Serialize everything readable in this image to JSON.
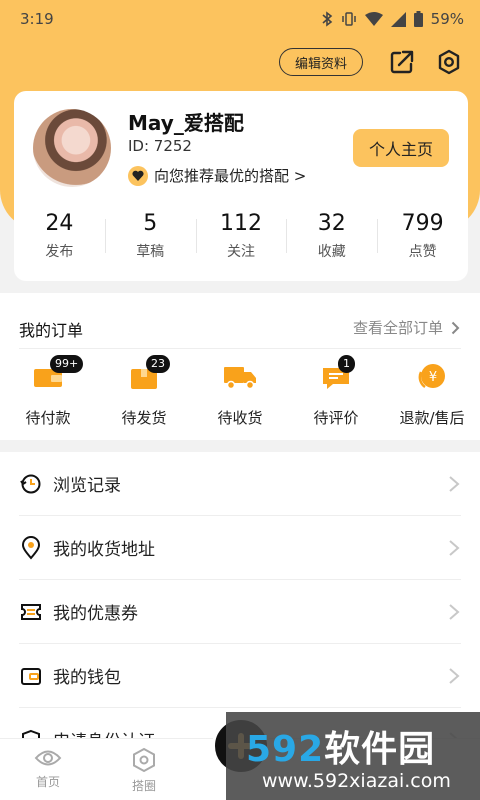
{
  "status_bar": {
    "time": "3:19",
    "battery": "59%"
  },
  "header": {
    "edit_label": "编辑资料"
  },
  "profile": {
    "username": "May_爱搭配",
    "id_label": "ID: 7252",
    "recommend_text": "向您推荐最优的搭配 >",
    "home_button": "个人主页"
  },
  "stats": [
    {
      "value": "24",
      "label": "发布"
    },
    {
      "value": "5",
      "label": "草稿"
    },
    {
      "value": "112",
      "label": "关注"
    },
    {
      "value": "32",
      "label": "收藏"
    },
    {
      "value": "799",
      "label": "点赞"
    }
  ],
  "orders": {
    "title": "我的订单",
    "view_all": "查看全部订单",
    "items": [
      {
        "label": "待付款",
        "badge": "99+",
        "icon": "wallet-icon"
      },
      {
        "label": "待发货",
        "badge": "23",
        "icon": "box-icon"
      },
      {
        "label": "待收货",
        "badge": "",
        "icon": "truck-icon"
      },
      {
        "label": "待评价",
        "badge": "1",
        "icon": "comment-icon"
      },
      {
        "label": "退款/售后",
        "badge": "",
        "icon": "refund-icon"
      }
    ]
  },
  "menu": [
    {
      "label": "浏览记录",
      "icon": "history-icon"
    },
    {
      "label": "我的收货地址",
      "icon": "location-icon"
    },
    {
      "label": "我的优惠券",
      "icon": "coupon-icon"
    },
    {
      "label": "我的钱包",
      "icon": "wallet-outline-icon"
    },
    {
      "label": "申请身份认证",
      "icon": "shield-icon"
    }
  ],
  "tabs": [
    {
      "label": "首页",
      "icon": "eye-icon"
    },
    {
      "label": "搭圈",
      "icon": "hexagon-icon"
    }
  ],
  "watermark": {
    "main_digits": "592",
    "main_text": "软件园",
    "sub": "www.592xiazai.com"
  },
  "colors": {
    "accent": "#fcc35e",
    "icon_orange": "#f9a21b"
  }
}
